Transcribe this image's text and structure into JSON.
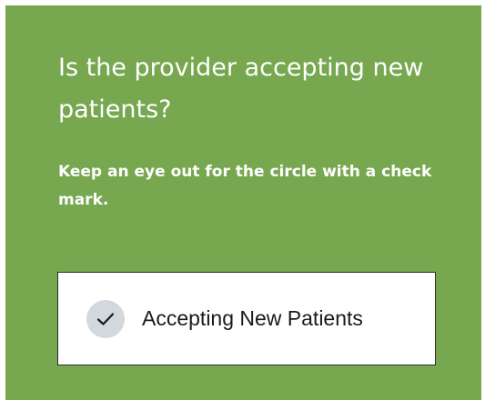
{
  "info_card": {
    "title": "Is the provider accepting new patients?",
    "subtitle": "Keep an eye out for the circle with a check mark.",
    "background_color": "#77a74f",
    "badge": {
      "icon": "check-icon",
      "label": "Accepting New Patients"
    }
  }
}
